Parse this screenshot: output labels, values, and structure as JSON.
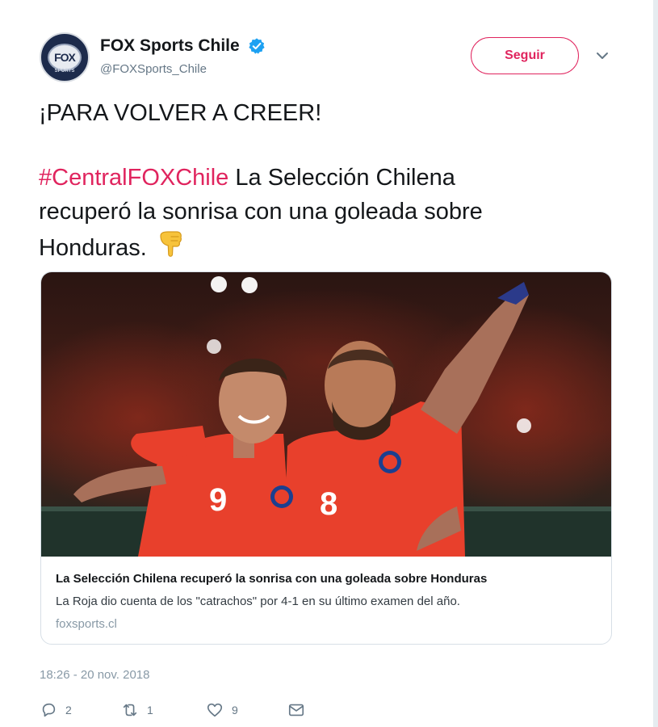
{
  "author": {
    "display_name": "FOX Sports Chile",
    "screen_name": "@FOXSports_Chile",
    "verified_icon": "verified-badge-icon",
    "avatar_text": "FOX",
    "avatar_subtext": "SPORTS"
  },
  "follow_label": "Seguir",
  "caret_icon": "chevron-down-icon",
  "tweet": {
    "line1": "¡PARA VOLVER A CREER!",
    "hashtag": "#CentralFOXChile",
    "line2_rest": " La Selección Chilena",
    "line3": "recuperó la sonrisa con una goleada sobre",
    "line4": "Honduras.",
    "emoji_icon": "pointing-down-hand-icon"
  },
  "card": {
    "title": "La Selección Chilena recuperó la sonrisa con una goleada sobre Honduras",
    "description": "La Roja dio cuenta de los \"catrachos\" por 4-1 en su último examen del año.",
    "domain": "foxsports.cl",
    "player_numbers": [
      "9",
      "8"
    ]
  },
  "timestamp": "18:26 - 20 nov. 2018",
  "actions": {
    "reply_count": "2",
    "retweet_count": "1",
    "like_count": "9",
    "reply_icon": "reply-icon",
    "retweet_icon": "retweet-icon",
    "like_icon": "heart-icon",
    "dm_icon": "envelope-icon"
  },
  "colors": {
    "hashtag": "#e0245e",
    "follow_button": "#e0245e",
    "verified": "#1da1f2",
    "jersey": "#e8402c"
  }
}
